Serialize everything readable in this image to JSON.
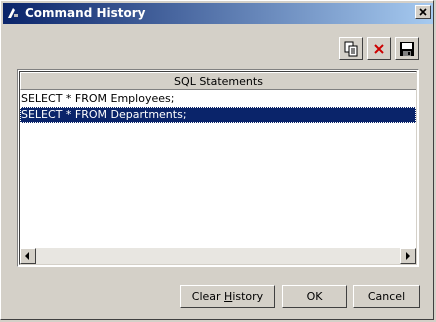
{
  "window": {
    "title": "Command History"
  },
  "toolbar": {
    "copy_icon": "copy-icon",
    "delete_icon": "delete-icon",
    "save_icon": "save-icon",
    "delete_color": "#cc0000"
  },
  "list": {
    "header": "SQL Statements",
    "rows": [
      "SELECT * FROM Employees;",
      "SELECT * FROM Departments;"
    ],
    "selected_index": 1
  },
  "buttons": {
    "clear_pre": "Clear ",
    "clear_u": "H",
    "clear_post": "istory",
    "ok": "OK",
    "cancel": "Cancel"
  },
  "colors": {
    "title_start": "#0a246a",
    "title_end": "#a6caf0",
    "selection": "#0a246a",
    "face": "#d4d0c8"
  }
}
